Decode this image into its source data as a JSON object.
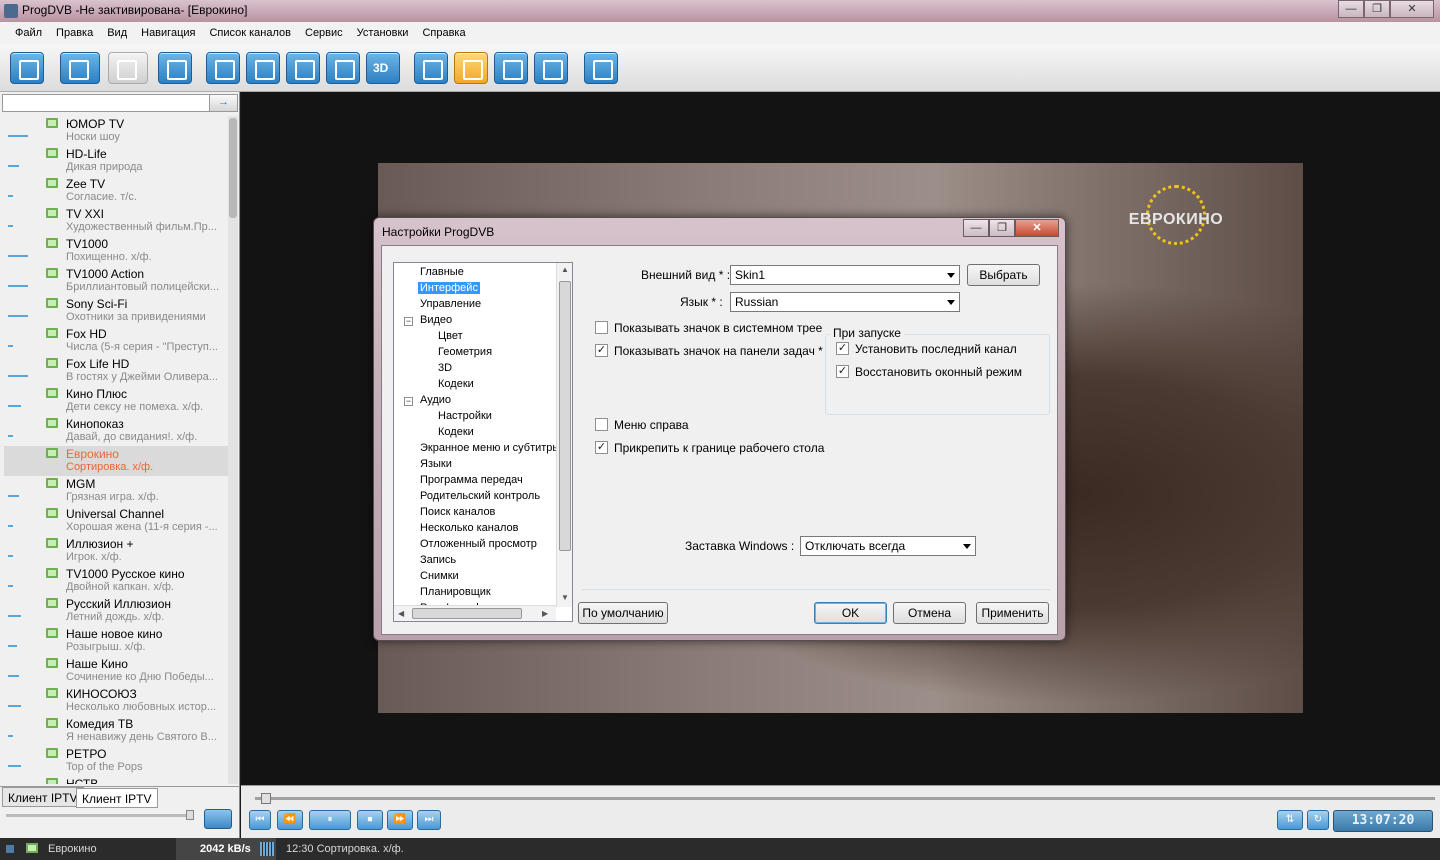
{
  "window": {
    "title": "ProgDVB -Не зактивирована-  [Еврокино]",
    "minimize": "—",
    "maximize": "❐",
    "close": "✕"
  },
  "menu": [
    "Файл",
    "Правка",
    "Вид",
    "Навигация",
    "Список каналов",
    "Сервис",
    "Установки",
    "Справка"
  ],
  "toolbar_icons": [
    "window-icon",
    "back-icon",
    "forward-icon",
    "zoom-icon",
    "window-normal-icon",
    "window-fit-icon",
    "grid-2x2-icon",
    "grid-multi-icon",
    "3d-icon",
    "download-icon",
    "osd-icon",
    "list-icon",
    "clock-icon",
    "gear-icon"
  ],
  "toolbar_3d_label": "3D",
  "search": {
    "value": "",
    "go_icon": "→"
  },
  "channels": [
    {
      "name": "ЮМОР TV",
      "program": "Носки шоу",
      "progress": 0.45
    },
    {
      "name": "HD-Life",
      "program": "Дикая природа",
      "progress": 0.25
    },
    {
      "name": "Zee TV",
      "program": "Согласие. т/с.",
      "progress": 0.12
    },
    {
      "name": "TV XXI",
      "program": "Художественный фильм.Пр...",
      "progress": 0.12
    },
    {
      "name": "TV1000",
      "program": "Похищенно. х/ф.",
      "progress": 0.45
    },
    {
      "name": "TV1000 Action",
      "program": "Бриллиантовый полицейски...",
      "progress": 0.45
    },
    {
      "name": "Sony Sci-Fi",
      "program": "Охотники за привидениями",
      "progress": 0.45
    },
    {
      "name": "Fox HD",
      "program": "Числа (5-я серия - \"Преступ...",
      "progress": 0.12
    },
    {
      "name": "Fox Life HD",
      "program": "В гостях у Джейми Оливера...",
      "progress": 0.45
    },
    {
      "name": "Кино Плюс",
      "program": "Дети сексу не помеха. х/ф.",
      "progress": 0.3
    },
    {
      "name": "Кинопоказ",
      "program": "Давай, до свидания!. х/ф.",
      "progress": 0.12
    },
    {
      "name": "Еврокино",
      "program": "Сортировка. х/ф.",
      "progress": 0.0,
      "selected": true
    },
    {
      "name": "MGM",
      "program": "Грязная игра. х/ф.",
      "progress": 0.25
    },
    {
      "name": "Universal Channel",
      "program": "Хорошая жена (11-я серия -...",
      "progress": 0.12
    },
    {
      "name": "Иллюзион +",
      "program": "Игрок. х/ф.",
      "progress": 0.12
    },
    {
      "name": "TV1000 Русское кино",
      "program": "Двойной капкан. х/ф.",
      "progress": 0.12
    },
    {
      "name": "Русский Иллюзион",
      "program": "Летний дождь. х/ф.",
      "progress": 0.3
    },
    {
      "name": "Наше новое кино",
      "program": "Розыгрыш. х/ф.",
      "progress": 0.2
    },
    {
      "name": "Наше Кино",
      "program": "Сочинение ко Дню Победы...",
      "progress": 0.25
    },
    {
      "name": "КИНОСОЮЗ",
      "program": "Несколько любовных истор...",
      "progress": 0.3
    },
    {
      "name": "Комедия ТВ",
      "program": "Я ненавижу день Святого В...",
      "progress": 0.12
    },
    {
      "name": "РЕТРО",
      "program": "Top of the Pops",
      "progress": 0.3
    },
    {
      "name": "НСТВ",
      "program": "",
      "progress": 0.0
    }
  ],
  "left_tabs": [
    "Клиент IPTV",
    "Клиент IPTV"
  ],
  "video": {
    "logo_text": "ЕВРОКИНО"
  },
  "playback": {
    "buttons": [
      "⏮",
      "⏪",
      "⏸",
      "⏹",
      "⏩",
      "⏭"
    ],
    "time": "13:07:20",
    "aspect_icon": "⇅",
    "refresh_icon": "↻"
  },
  "status": {
    "channel": "Еврокино",
    "rate": "2042 kB/s",
    "program": "12:30 Сортировка. х/ф."
  },
  "dialog": {
    "title": "Настройки ProgDVB",
    "tree": [
      {
        "label": "Главные",
        "level": 1
      },
      {
        "label": "Интерфейс",
        "level": 1,
        "selected": true
      },
      {
        "label": "Управление",
        "level": 1
      },
      {
        "label": "Видео",
        "level": 1,
        "expander": "−"
      },
      {
        "label": "Цвет",
        "level": 2
      },
      {
        "label": "Геометрия",
        "level": 2
      },
      {
        "label": "3D",
        "level": 2
      },
      {
        "label": "Кодеки",
        "level": 2
      },
      {
        "label": "Аудио",
        "level": 1,
        "expander": "−"
      },
      {
        "label": "Настройки",
        "level": 2
      },
      {
        "label": "Кодеки",
        "level": 2
      },
      {
        "label": "Экранное меню и субтитры",
        "level": 1
      },
      {
        "label": "Языки",
        "level": 1
      },
      {
        "label": "Программа передач",
        "level": 1
      },
      {
        "label": "Родительский контроль",
        "level": 1
      },
      {
        "label": "Поиск каналов",
        "level": 1
      },
      {
        "label": "Несколько каналов",
        "level": 1
      },
      {
        "label": "Отложенный просмотр",
        "level": 1
      },
      {
        "label": "Запись",
        "level": 1
      },
      {
        "label": "Снимки",
        "level": 1
      },
      {
        "label": "Планировщик",
        "level": 1
      },
      {
        "label": "Prog Launcher",
        "level": 1
      }
    ],
    "appearance_label": "Внешний вид * :",
    "appearance_value": "Skin1",
    "choose_button": "Выбрать",
    "language_label": "Язык * :",
    "language_value": "Russian",
    "options": {
      "tray_icon": {
        "label": "Показывать значок в системном трее",
        "checked": false
      },
      "taskbar_icon": {
        "label": "Показывать значок на панели задач *",
        "checked": true
      },
      "menu_right": {
        "label": "Меню справа",
        "checked": false
      },
      "dock_desktop": {
        "label": "Прикрепить к границе рабочего стола",
        "checked": true
      }
    },
    "startup": {
      "title": "При запуске",
      "last_channel": {
        "label": "Установить последний канал",
        "checked": true
      },
      "restore_window": {
        "label": "Восстановить оконный режим",
        "checked": true
      }
    },
    "screensaver_label": "Заставка Windows :",
    "screensaver_value": "Отключать всегда",
    "buttons": {
      "defaults": "По умолчанию",
      "ok": "OK",
      "cancel": "Отмена",
      "apply": "Применить"
    }
  }
}
